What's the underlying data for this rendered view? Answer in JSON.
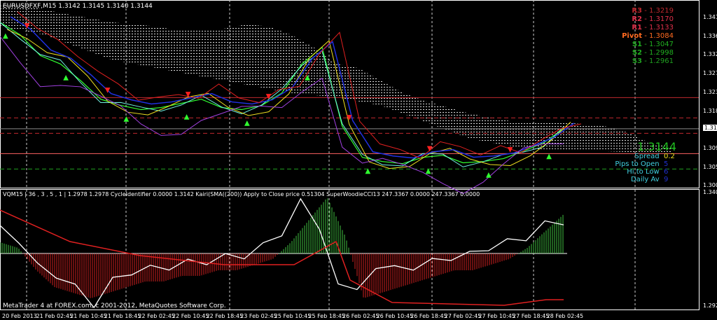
{
  "chart_data": {
    "type": "line",
    "title": "EURUSDFXF,M15",
    "ohlc": "1.3142 1.3145 1.3140 1.3144",
    "price_axis": {
      "ticks": [
        "1.3410",
        "1.3365",
        "1.3320",
        "1.3275",
        "1.3230",
        "1.3185",
        "1.3095",
        "1.3050",
        "1.3005"
      ],
      "ylim": [
        1.2985,
        1.3455
      ],
      "current": "1.3144"
    },
    "x_ticks": [
      "20 Feb 2013",
      "21 Feb 02:45",
      "21 Feb 10:45",
      "21 Feb 18:45",
      "22 Feb 02:45",
      "22 Feb 10:45",
      "22 Feb 18:45",
      "23 Feb 02:45",
      "25 Feb 10:45",
      "25 Feb 18:45",
      "26 Feb 02:45",
      "26 Feb 10:45",
      "26 Feb 18:45",
      "27 Feb 02:45",
      "27 Feb 10:45",
      "27 Feb 18:45",
      "28 Feb 02:45"
    ],
    "close": [
      1.34,
      1.337,
      1.332,
      1.33,
      1.326,
      1.3215,
      1.32,
      1.319,
      1.3195,
      1.3205,
      1.3215,
      1.3195,
      1.319,
      1.32,
      1.323,
      1.33,
      1.334,
      1.315,
      1.3075,
      1.3065,
      1.306,
      1.3075,
      1.308,
      1.3062,
      1.3065,
      1.3072,
      1.309,
      1.311,
      1.3144
    ],
    "cloud_upper": [
      1.344,
      1.344,
      1.343,
      1.342,
      1.341,
      1.34,
      1.3395,
      1.339,
      1.338,
      1.338,
      1.3385,
      1.3395,
      1.339,
      1.337,
      1.334,
      1.33,
      1.329,
      1.326,
      1.323,
      1.321,
      1.3195,
      1.318,
      1.317,
      1.316,
      1.316,
      1.316,
      1.3155,
      1.315,
      1.3135,
      1.311,
      1.31
    ],
    "cloud_lower": [
      1.339,
      1.338,
      1.337,
      1.335,
      1.333,
      1.331,
      1.33,
      1.329,
      1.328,
      1.327,
      1.326,
      1.325,
      1.324,
      1.323,
      1.3225,
      1.322,
      1.321,
      1.32,
      1.318,
      1.316,
      1.314,
      1.312,
      1.311,
      1.31,
      1.3095,
      1.3095,
      1.3092,
      1.309,
      1.3088,
      1.3085,
      1.3085
    ],
    "levels": [
      {
        "name": "R3",
        "value": "1.3219",
        "color": "#c0282e"
      },
      {
        "name": "R2",
        "value": "1.3170",
        "color": "#e0304a"
      },
      {
        "name": "R1",
        "value": "1.3133",
        "color": "#e0304a"
      },
      {
        "name": "Pivot",
        "value": "1.3084",
        "color": "#ff6a20"
      },
      {
        "name": "S1",
        "value": "1.3047",
        "color": "#20b020"
      },
      {
        "name": "S2",
        "value": "1.2998",
        "color": "#20b020"
      },
      {
        "name": "S3",
        "value": "1.2961",
        "color": "#20a020"
      }
    ],
    "info": {
      "price": "1.3144",
      "spread_label": "Spread",
      "spread": "0.2",
      "pips_label": "Pips to Open",
      "pips": "5",
      "hilo_label": "Hi to Low",
      "hilo": "6",
      "daily_label": "Daily Av",
      "daily": "9"
    },
    "indicator": {
      "header": "VQM15 | 36 , 3 , 5 , 1 | 1.2978 1.2978 CycleIdentifier 0.0000 1.3142 Kairi(SMA((200)) Apply to Close price 0.51304 SuperWoodieCCI13 247.3367 0.0000 247.3367 0.0000",
      "ticks": [
        "1.3409",
        "1.2923"
      ],
      "ylim": [
        1.2923,
        1.3409
      ],
      "histogram": [
        0.2,
        0.1,
        -0.3,
        -0.6,
        -0.7,
        -0.8,
        -0.7,
        -0.6,
        -0.5,
        -0.5,
        -0.4,
        -0.4,
        -0.3,
        -0.3,
        -0.2,
        -0.1,
        0.2,
        0.6,
        1.0,
        0.3,
        -0.8,
        -0.7,
        -0.6,
        -0.5,
        -0.4,
        -0.3,
        -0.3,
        -0.2,
        -0.1,
        0.1,
        0.4,
        0.7
      ],
      "oscillator": [
        0.5,
        0.2,
        -0.2,
        -0.4,
        -0.6,
        -0.9,
        -0.5,
        -0.3,
        -0.3,
        -0.2,
        -0.2,
        -0.1,
        -0.1,
        0.0,
        0.1,
        0.4,
        0.9,
        0.5,
        -0.6,
        -0.6,
        -0.3,
        -0.2,
        -0.3,
        -0.1,
        -0.1,
        0.0,
        0.1,
        0.2,
        0.3,
        0.5,
        0.6
      ]
    }
  },
  "footer": "MetaTrader 4 at FOREX.com, c 2001-2012, MetaQuotes Software Corp."
}
